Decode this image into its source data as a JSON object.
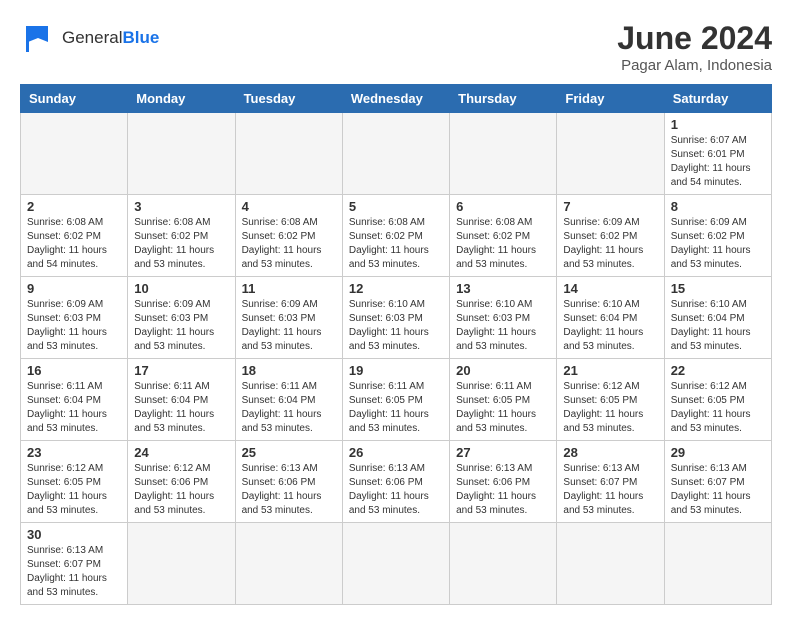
{
  "header": {
    "logo_general": "General",
    "logo_blue": "Blue",
    "month_title": "June 2024",
    "location": "Pagar Alam, Indonesia"
  },
  "weekdays": [
    "Sunday",
    "Monday",
    "Tuesday",
    "Wednesday",
    "Thursday",
    "Friday",
    "Saturday"
  ],
  "weeks": [
    [
      {
        "day": "",
        "info": ""
      },
      {
        "day": "",
        "info": ""
      },
      {
        "day": "",
        "info": ""
      },
      {
        "day": "",
        "info": ""
      },
      {
        "day": "",
        "info": ""
      },
      {
        "day": "",
        "info": ""
      },
      {
        "day": "1",
        "info": "Sunrise: 6:07 AM\nSunset: 6:01 PM\nDaylight: 11 hours\nand 54 minutes."
      }
    ],
    [
      {
        "day": "2",
        "info": "Sunrise: 6:08 AM\nSunset: 6:02 PM\nDaylight: 11 hours\nand 54 minutes."
      },
      {
        "day": "3",
        "info": "Sunrise: 6:08 AM\nSunset: 6:02 PM\nDaylight: 11 hours\nand 53 minutes."
      },
      {
        "day": "4",
        "info": "Sunrise: 6:08 AM\nSunset: 6:02 PM\nDaylight: 11 hours\nand 53 minutes."
      },
      {
        "day": "5",
        "info": "Sunrise: 6:08 AM\nSunset: 6:02 PM\nDaylight: 11 hours\nand 53 minutes."
      },
      {
        "day": "6",
        "info": "Sunrise: 6:08 AM\nSunset: 6:02 PM\nDaylight: 11 hours\nand 53 minutes."
      },
      {
        "day": "7",
        "info": "Sunrise: 6:09 AM\nSunset: 6:02 PM\nDaylight: 11 hours\nand 53 minutes."
      },
      {
        "day": "8",
        "info": "Sunrise: 6:09 AM\nSunset: 6:02 PM\nDaylight: 11 hours\nand 53 minutes."
      }
    ],
    [
      {
        "day": "9",
        "info": "Sunrise: 6:09 AM\nSunset: 6:03 PM\nDaylight: 11 hours\nand 53 minutes."
      },
      {
        "day": "10",
        "info": "Sunrise: 6:09 AM\nSunset: 6:03 PM\nDaylight: 11 hours\nand 53 minutes."
      },
      {
        "day": "11",
        "info": "Sunrise: 6:09 AM\nSunset: 6:03 PM\nDaylight: 11 hours\nand 53 minutes."
      },
      {
        "day": "12",
        "info": "Sunrise: 6:10 AM\nSunset: 6:03 PM\nDaylight: 11 hours\nand 53 minutes."
      },
      {
        "day": "13",
        "info": "Sunrise: 6:10 AM\nSunset: 6:03 PM\nDaylight: 11 hours\nand 53 minutes."
      },
      {
        "day": "14",
        "info": "Sunrise: 6:10 AM\nSunset: 6:04 PM\nDaylight: 11 hours\nand 53 minutes."
      },
      {
        "day": "15",
        "info": "Sunrise: 6:10 AM\nSunset: 6:04 PM\nDaylight: 11 hours\nand 53 minutes."
      }
    ],
    [
      {
        "day": "16",
        "info": "Sunrise: 6:11 AM\nSunset: 6:04 PM\nDaylight: 11 hours\nand 53 minutes."
      },
      {
        "day": "17",
        "info": "Sunrise: 6:11 AM\nSunset: 6:04 PM\nDaylight: 11 hours\nand 53 minutes."
      },
      {
        "day": "18",
        "info": "Sunrise: 6:11 AM\nSunset: 6:04 PM\nDaylight: 11 hours\nand 53 minutes."
      },
      {
        "day": "19",
        "info": "Sunrise: 6:11 AM\nSunset: 6:05 PM\nDaylight: 11 hours\nand 53 minutes."
      },
      {
        "day": "20",
        "info": "Sunrise: 6:11 AM\nSunset: 6:05 PM\nDaylight: 11 hours\nand 53 minutes."
      },
      {
        "day": "21",
        "info": "Sunrise: 6:12 AM\nSunset: 6:05 PM\nDaylight: 11 hours\nand 53 minutes."
      },
      {
        "day": "22",
        "info": "Sunrise: 6:12 AM\nSunset: 6:05 PM\nDaylight: 11 hours\nand 53 minutes."
      }
    ],
    [
      {
        "day": "23",
        "info": "Sunrise: 6:12 AM\nSunset: 6:05 PM\nDaylight: 11 hours\nand 53 minutes."
      },
      {
        "day": "24",
        "info": "Sunrise: 6:12 AM\nSunset: 6:06 PM\nDaylight: 11 hours\nand 53 minutes."
      },
      {
        "day": "25",
        "info": "Sunrise: 6:13 AM\nSunset: 6:06 PM\nDaylight: 11 hours\nand 53 minutes."
      },
      {
        "day": "26",
        "info": "Sunrise: 6:13 AM\nSunset: 6:06 PM\nDaylight: 11 hours\nand 53 minutes."
      },
      {
        "day": "27",
        "info": "Sunrise: 6:13 AM\nSunset: 6:06 PM\nDaylight: 11 hours\nand 53 minutes."
      },
      {
        "day": "28",
        "info": "Sunrise: 6:13 AM\nSunset: 6:07 PM\nDaylight: 11 hours\nand 53 minutes."
      },
      {
        "day": "29",
        "info": "Sunrise: 6:13 AM\nSunset: 6:07 PM\nDaylight: 11 hours\nand 53 minutes."
      }
    ],
    [
      {
        "day": "30",
        "info": "Sunrise: 6:13 AM\nSunset: 6:07 PM\nDaylight: 11 hours\nand 53 minutes."
      },
      {
        "day": "",
        "info": ""
      },
      {
        "day": "",
        "info": ""
      },
      {
        "day": "",
        "info": ""
      },
      {
        "day": "",
        "info": ""
      },
      {
        "day": "",
        "info": ""
      },
      {
        "day": "",
        "info": ""
      }
    ]
  ]
}
